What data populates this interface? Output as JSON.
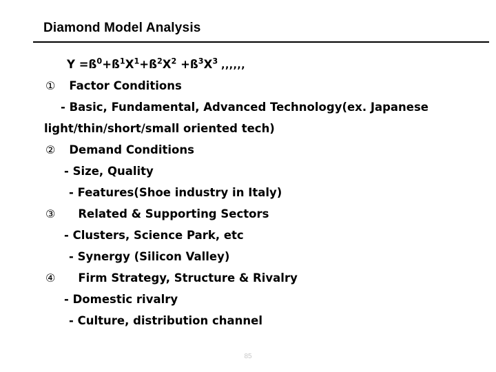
{
  "slide": {
    "title": "Diamond Model Analysis",
    "page_number": "85",
    "formula": {
      "lead": "Y =ß",
      "exp0": "0",
      "t1": "+ß",
      "exp1a": "1",
      "x1": "X",
      "exp1b": "1",
      "t2": "+ß",
      "exp2a": "2",
      "x2": "X",
      "exp2b": "2",
      "t3": " +ß",
      "exp3a": "3",
      "x3": "X",
      "exp3b": "3",
      "trailing": ",,,,,,"
    },
    "items": [
      {
        "marker": "①",
        "heading": "Factor Conditions",
        "bullets": [
          "- Basic, Fundamental, Advanced Technology(ex. Japanese",
          "light/thin/short/small oriented tech)"
        ]
      },
      {
        "marker": "②",
        "heading": "Demand Conditions",
        "bullets": [
          "- Size, Quality",
          "- Features(Shoe industry in Italy)"
        ]
      },
      {
        "marker": "③",
        "heading": "Related & Supporting Sectors",
        "bullets": [
          "- Clusters, Science Park, etc",
          "- Synergy (Silicon Valley)"
        ]
      },
      {
        "marker": "④",
        "heading": "Firm Strategy, Structure & Rivalry",
        "bullets": [
          "- Domestic rivalry",
          "- Culture, distribution channel"
        ]
      }
    ]
  },
  "colors": {
    "background": "#ffffff",
    "text": "#000000",
    "rule": "#000000",
    "page_number": "#c8c8c8"
  }
}
